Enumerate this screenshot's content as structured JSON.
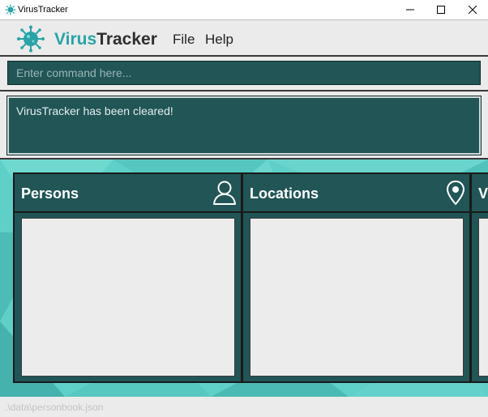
{
  "window": {
    "title": "VirusTracker"
  },
  "header": {
    "brand_part1": "Virus",
    "brand_part2": "Tracker",
    "menu": {
      "file": "File",
      "help": "Help"
    }
  },
  "command": {
    "placeholder": "Enter command here..."
  },
  "result": {
    "text": "VirusTracker has been cleared!"
  },
  "panels": {
    "persons": {
      "title": "Persons",
      "icon": "person-icon"
    },
    "locations": {
      "title": "Locations",
      "icon": "location-pin-icon"
    },
    "third": {
      "title": "V"
    }
  },
  "status": {
    "path": ".\\data\\personbook.json"
  },
  "colors": {
    "accent": "#2aa3a6",
    "panel": "#215556",
    "background": "#5fd0c8"
  }
}
